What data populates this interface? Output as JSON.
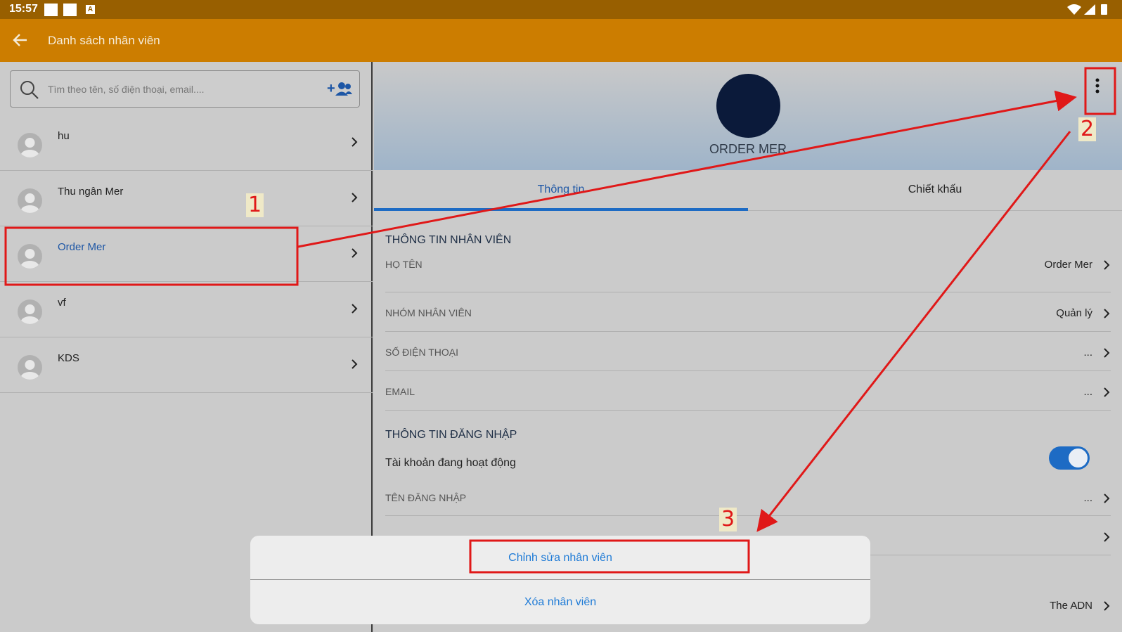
{
  "statusbar": {
    "time": "15:57"
  },
  "appbar": {
    "title": "Danh sách nhân viên"
  },
  "search": {
    "placeholder": "Tìm theo tên, số điện thoại, email...."
  },
  "employees": [
    {
      "name": "hu"
    },
    {
      "name": "Thu ngân Mer"
    },
    {
      "name": "Order Mer"
    },
    {
      "name": "vf"
    },
    {
      "name": "KDS"
    }
  ],
  "profile": {
    "name": "ORDER MER"
  },
  "tabs": [
    {
      "label": "Thông tin"
    },
    {
      "label": "Chiết khấu"
    }
  ],
  "section_info": "THÔNG TIN NHÂN VIÊN",
  "fields": [
    {
      "label": "HỌ TÊN",
      "value": "Order Mer"
    },
    {
      "label": "NHÓM NHÂN VIÊN",
      "value": "Quản lý"
    },
    {
      "label": "SỐ ĐIỆN THOẠI",
      "value": "..."
    },
    {
      "label": "EMAIL",
      "value": "..."
    }
  ],
  "section_login": "THÔNG TIN ĐĂNG NHẬP",
  "account_active": {
    "label": "Tài khoản đang hoạt động",
    "on": true
  },
  "login_fields": [
    {
      "label": "TÊN ĐĂNG NHẬP",
      "value": "..."
    },
    {
      "label": "",
      "value": ""
    }
  ],
  "store": {
    "value": "The ADN"
  },
  "sheet": {
    "edit_label": "Chỉnh sửa nhân viên",
    "delete_label": "Xóa nhân viên"
  },
  "annotations": {
    "n1": "1",
    "n2": "2",
    "n3": "3"
  },
  "colors": {
    "appbar": "#cc7d00",
    "statusbar": "#985f00",
    "accent": "#1d6bc4",
    "annotation": "#e01818"
  }
}
